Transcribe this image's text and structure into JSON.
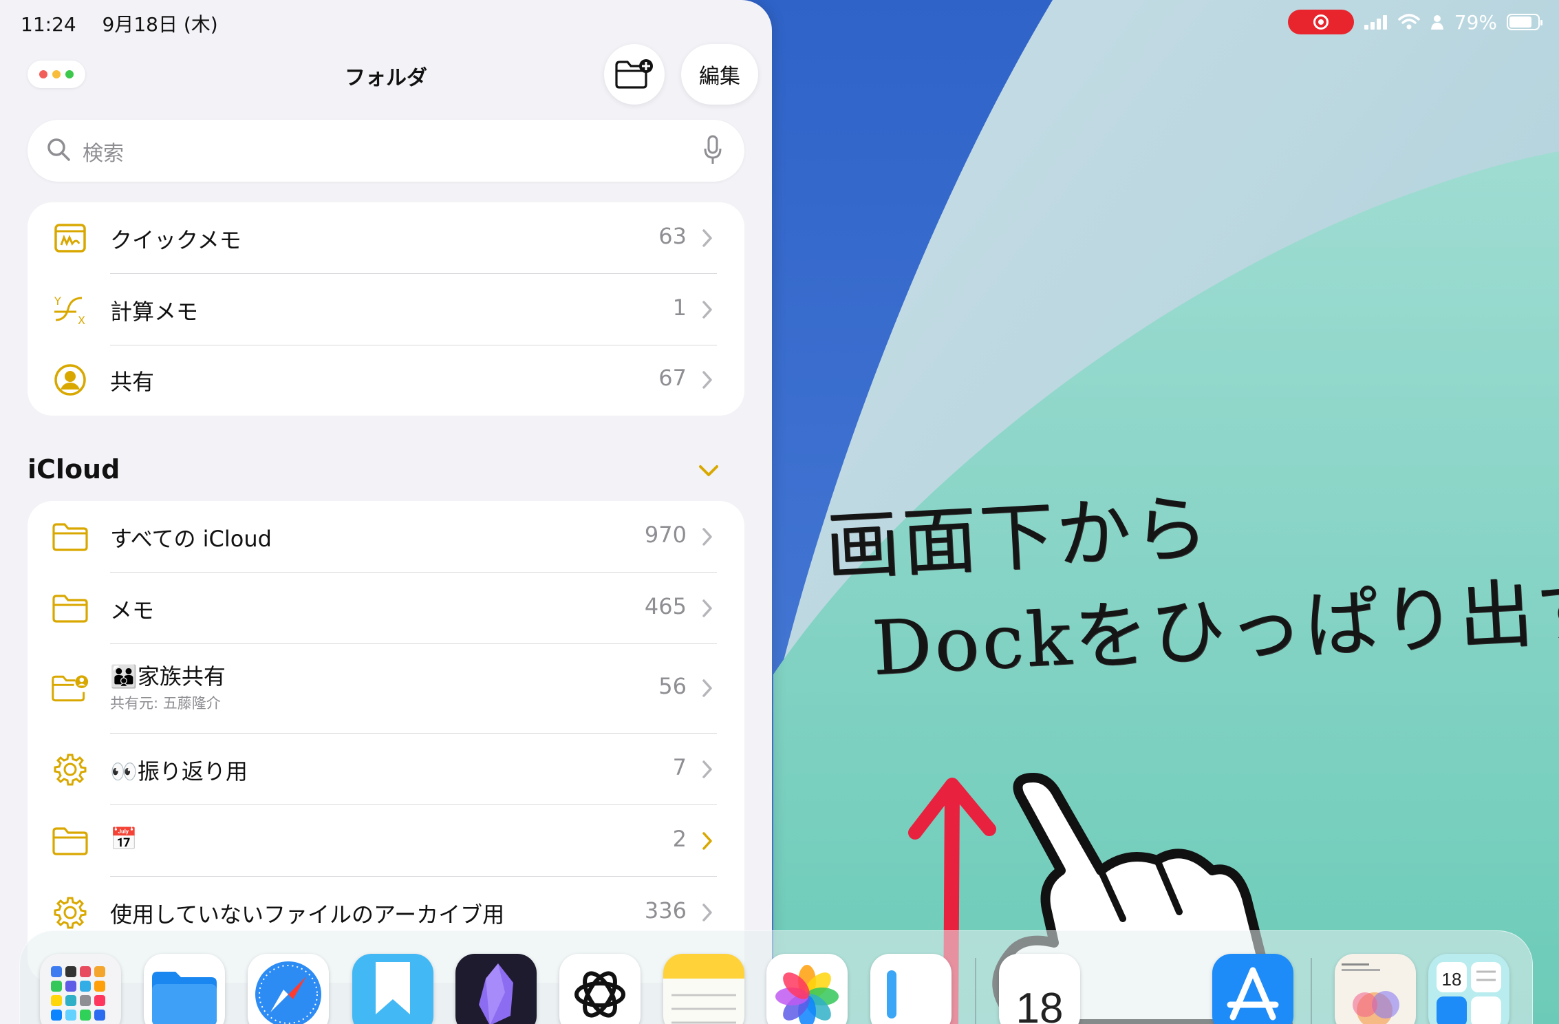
{
  "status_bar": {
    "time": "11:24",
    "date": "9月18日 (木)",
    "battery_text": "79%",
    "battery_level": 0.79,
    "recording": true,
    "recording_color": "#e8242c"
  },
  "notes": {
    "title": "フォルダ",
    "new_folder_icon": "folder-plus-icon",
    "edit_label": "編集",
    "search_placeholder": "検索",
    "accent_color": "#d9a800",
    "pinned": [
      {
        "label": "クイックメモ",
        "count": "63",
        "icon": "quick-note-icon"
      },
      {
        "label": "計算メモ",
        "count": "1",
        "icon": "math-notes-icon"
      },
      {
        "label": "共有",
        "count": "67",
        "icon": "person-circle-icon"
      }
    ],
    "icloud_title": "iCloud",
    "icloud": [
      {
        "label": "すべての iCloud",
        "count": "970",
        "icon": "folder-icon"
      },
      {
        "label": "メモ",
        "count": "465",
        "icon": "folder-icon"
      },
      {
        "label": "🧑‍🧑‍🧒家族共有",
        "sublabel": "共有元: 五藤隆介",
        "count": "56",
        "icon": "shared-folder-icon"
      },
      {
        "label": "👀振り返り用",
        "count": "7",
        "icon": "gear-icon"
      },
      {
        "label": "📅",
        "count": "2",
        "icon": "folder-icon"
      },
      {
        "label": "使用していないファイルのアーカイブ用",
        "count": "336",
        "icon": "gear-icon"
      }
    ]
  },
  "annotation": {
    "line1": "画面下から",
    "line2": "Dockをひっぱり出す",
    "arrow_color": "#e8213f"
  },
  "dock": {
    "apps": [
      {
        "name": "app-library",
        "icon": "app-library-icon"
      },
      {
        "name": "files",
        "icon": "files-icon"
      },
      {
        "name": "safari",
        "icon": "safari-icon"
      },
      {
        "name": "day-one",
        "icon": "bookmark-icon"
      },
      {
        "name": "obsidian",
        "icon": "obsidian-icon"
      },
      {
        "name": "chatgpt",
        "icon": "chatgpt-icon"
      },
      {
        "name": "notes",
        "icon": "notes-icon"
      },
      {
        "name": "photos",
        "icon": "photos-icon"
      },
      {
        "name": "text-app",
        "icon": "text-app-icon"
      },
      {
        "name": "calendar",
        "icon": "calendar-icon"
      },
      {
        "name": "app-store",
        "icon": "app-store-icon"
      },
      {
        "name": "recent-book",
        "icon": "book-icon"
      },
      {
        "name": "recent-folder",
        "icon": "folder-stack-icon"
      }
    ],
    "calendar_day": "18"
  }
}
